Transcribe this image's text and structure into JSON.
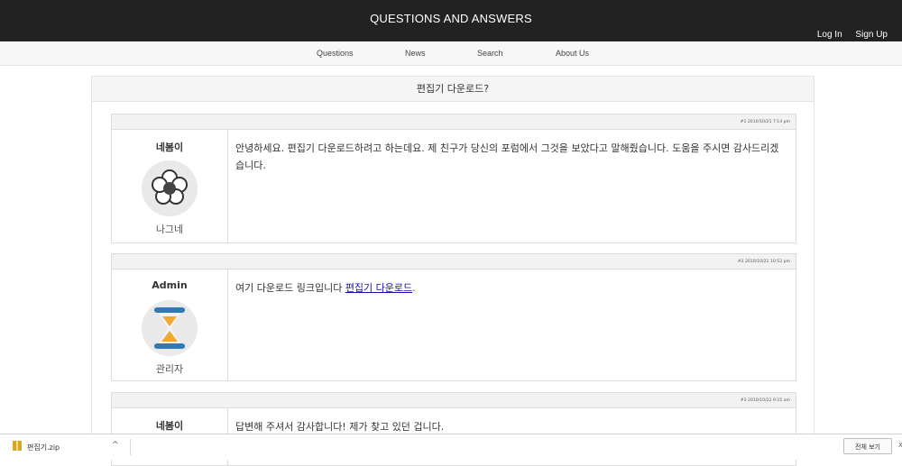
{
  "header": {
    "title": "QUESTIONS AND ANSWERS",
    "login": "Log In",
    "signup": "Sign Up"
  },
  "nav": {
    "questions": "Questions",
    "news": "News",
    "search": "Search",
    "about": "About Us"
  },
  "thread": {
    "title": "편집기 다운로드?",
    "posts": [
      {
        "meta": "#1 2010/10/21 7:14 pm",
        "author": "네봄이",
        "role": "나그네",
        "avatar_icon": "flower-icon",
        "body": "안녕하세요. 편집기 다운로드하려고 하는데요. 제 친구가 당신의 포럼에서 그것을 보았다고 말해줬습니다. 도움을 주시면 감사드리겠습니다."
      },
      {
        "meta": "#2 2010/10/21 10:52 pm",
        "author": "Admin",
        "role": "관리자",
        "avatar_icon": "hourglass-icon",
        "body": "여기 다운로드 링크입니다 ",
        "link": "편집기 다운로드",
        "after_link": "."
      },
      {
        "meta": "#3 2010/10/22 9:15 am",
        "author": "네봄이",
        "body": "답변해 주셔서 감사합니다! 제가 찾고 있던 겁니다."
      }
    ]
  },
  "download_bar": {
    "file": "편집기.zip",
    "file_icon": "zip-file-icon",
    "chevron": "^",
    "show_all": "전체 보기",
    "close": "X"
  },
  "colors": {
    "header_bg": "#222222",
    "link": "#1a0dab",
    "hourglass_frame": "#2f79b6",
    "hourglass_sand": "#f0a830"
  }
}
